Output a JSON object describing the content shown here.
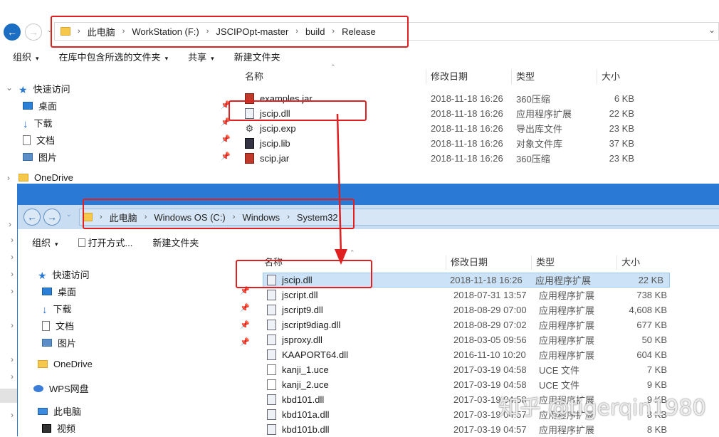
{
  "back_window": {
    "breadcrumb": [
      "此电脑",
      "WorkStation (F:)",
      "JSCIPOpt-master",
      "build",
      "Release"
    ],
    "toolbar": {
      "organize": "组织",
      "include_library": "在库中包含所选的文件夹",
      "share": "共享",
      "new_folder": "新建文件夹"
    },
    "nav": {
      "quick_access": "快速访问",
      "desktop": "桌面",
      "downloads": "下载",
      "documents": "文档",
      "pictures": "图片",
      "onedrive": "OneDrive"
    },
    "columns": {
      "name": "名称",
      "date": "修改日期",
      "type": "类型",
      "size": "大小"
    },
    "files": [
      {
        "name": "examples.jar",
        "date": "2018-11-18 16:26",
        "type": "360压缩",
        "size": "6 KB",
        "icon": "jar-icon"
      },
      {
        "name": "jscip.dll",
        "date": "2018-11-18 16:26",
        "type": "应用程序扩展",
        "size": "22 KB",
        "icon": "dll-icon"
      },
      {
        "name": "jscip.exp",
        "date": "2018-11-18 16:26",
        "type": "导出库文件",
        "size": "23 KB",
        "icon": "gear-file-icon"
      },
      {
        "name": "jscip.lib",
        "date": "2018-11-18 16:26",
        "type": "对象文件库",
        "size": "37 KB",
        "icon": "lib-icon"
      },
      {
        "name": "scip.jar",
        "date": "2018-11-18 16:26",
        "type": "360压缩",
        "size": "23 KB",
        "icon": "jar-icon"
      }
    ]
  },
  "front_window": {
    "breadcrumb": [
      "此电脑",
      "Windows OS (C:)",
      "Windows",
      "System32"
    ],
    "toolbar": {
      "organize": "组织",
      "open_with": "打开方式...",
      "new_folder": "新建文件夹"
    },
    "nav": {
      "quick_access": "快速访问",
      "desktop": "桌面",
      "downloads": "下载",
      "documents": "文档",
      "pictures": "图片",
      "onedrive": "OneDrive",
      "wps": "WPS网盘",
      "this_pc": "此电脑",
      "videos": "视频"
    },
    "columns": {
      "name": "名称",
      "date": "修改日期",
      "type": "类型",
      "size": "大小"
    },
    "files": [
      {
        "name": "jscip.dll",
        "date": "2018-11-18 16:26",
        "type": "应用程序扩展",
        "size": "22 KB",
        "icon": "dll-icon",
        "selected": true
      },
      {
        "name": "jscript.dll",
        "date": "2018-07-31 13:57",
        "type": "应用程序扩展",
        "size": "738 KB",
        "icon": "dll-icon"
      },
      {
        "name": "jscript9.dll",
        "date": "2018-08-29 07:00",
        "type": "应用程序扩展",
        "size": "4,608 KB",
        "icon": "dll-icon"
      },
      {
        "name": "jscript9diag.dll",
        "date": "2018-08-29 07:02",
        "type": "应用程序扩展",
        "size": "677 KB",
        "icon": "dll-icon"
      },
      {
        "name": "jsproxy.dll",
        "date": "2018-03-05 09:56",
        "type": "应用程序扩展",
        "size": "50 KB",
        "icon": "dll-icon"
      },
      {
        "name": "KAAPORT64.dll",
        "date": "2016-11-10 10:20",
        "type": "应用程序扩展",
        "size": "604 KB",
        "icon": "dll-icon"
      },
      {
        "name": "kanji_1.uce",
        "date": "2017-03-19 04:58",
        "type": "UCE 文件",
        "size": "7 KB",
        "icon": "uce-icon"
      },
      {
        "name": "kanji_2.uce",
        "date": "2017-03-19 04:58",
        "type": "UCE 文件",
        "size": "9 KB",
        "icon": "uce-icon"
      },
      {
        "name": "kbd101.dll",
        "date": "2017-03-19 04:58",
        "type": "应用程序扩展",
        "size": "9 KB",
        "icon": "dll-icon"
      },
      {
        "name": "kbd101a.dll",
        "date": "2017-03-19 04:57",
        "type": "应用程序扩展",
        "size": "8 KB",
        "icon": "dll-icon"
      },
      {
        "name": "kbd101b.dll",
        "date": "2017-03-19 04:57",
        "type": "应用程序扩展",
        "size": "8 KB",
        "icon": "dll-icon"
      }
    ]
  },
  "watermark": "知乎 @tigerqin1980",
  "colors": {
    "accent": "#2a7ad5",
    "annotation_red": "#e02020",
    "selection": "#cce3f7"
  }
}
